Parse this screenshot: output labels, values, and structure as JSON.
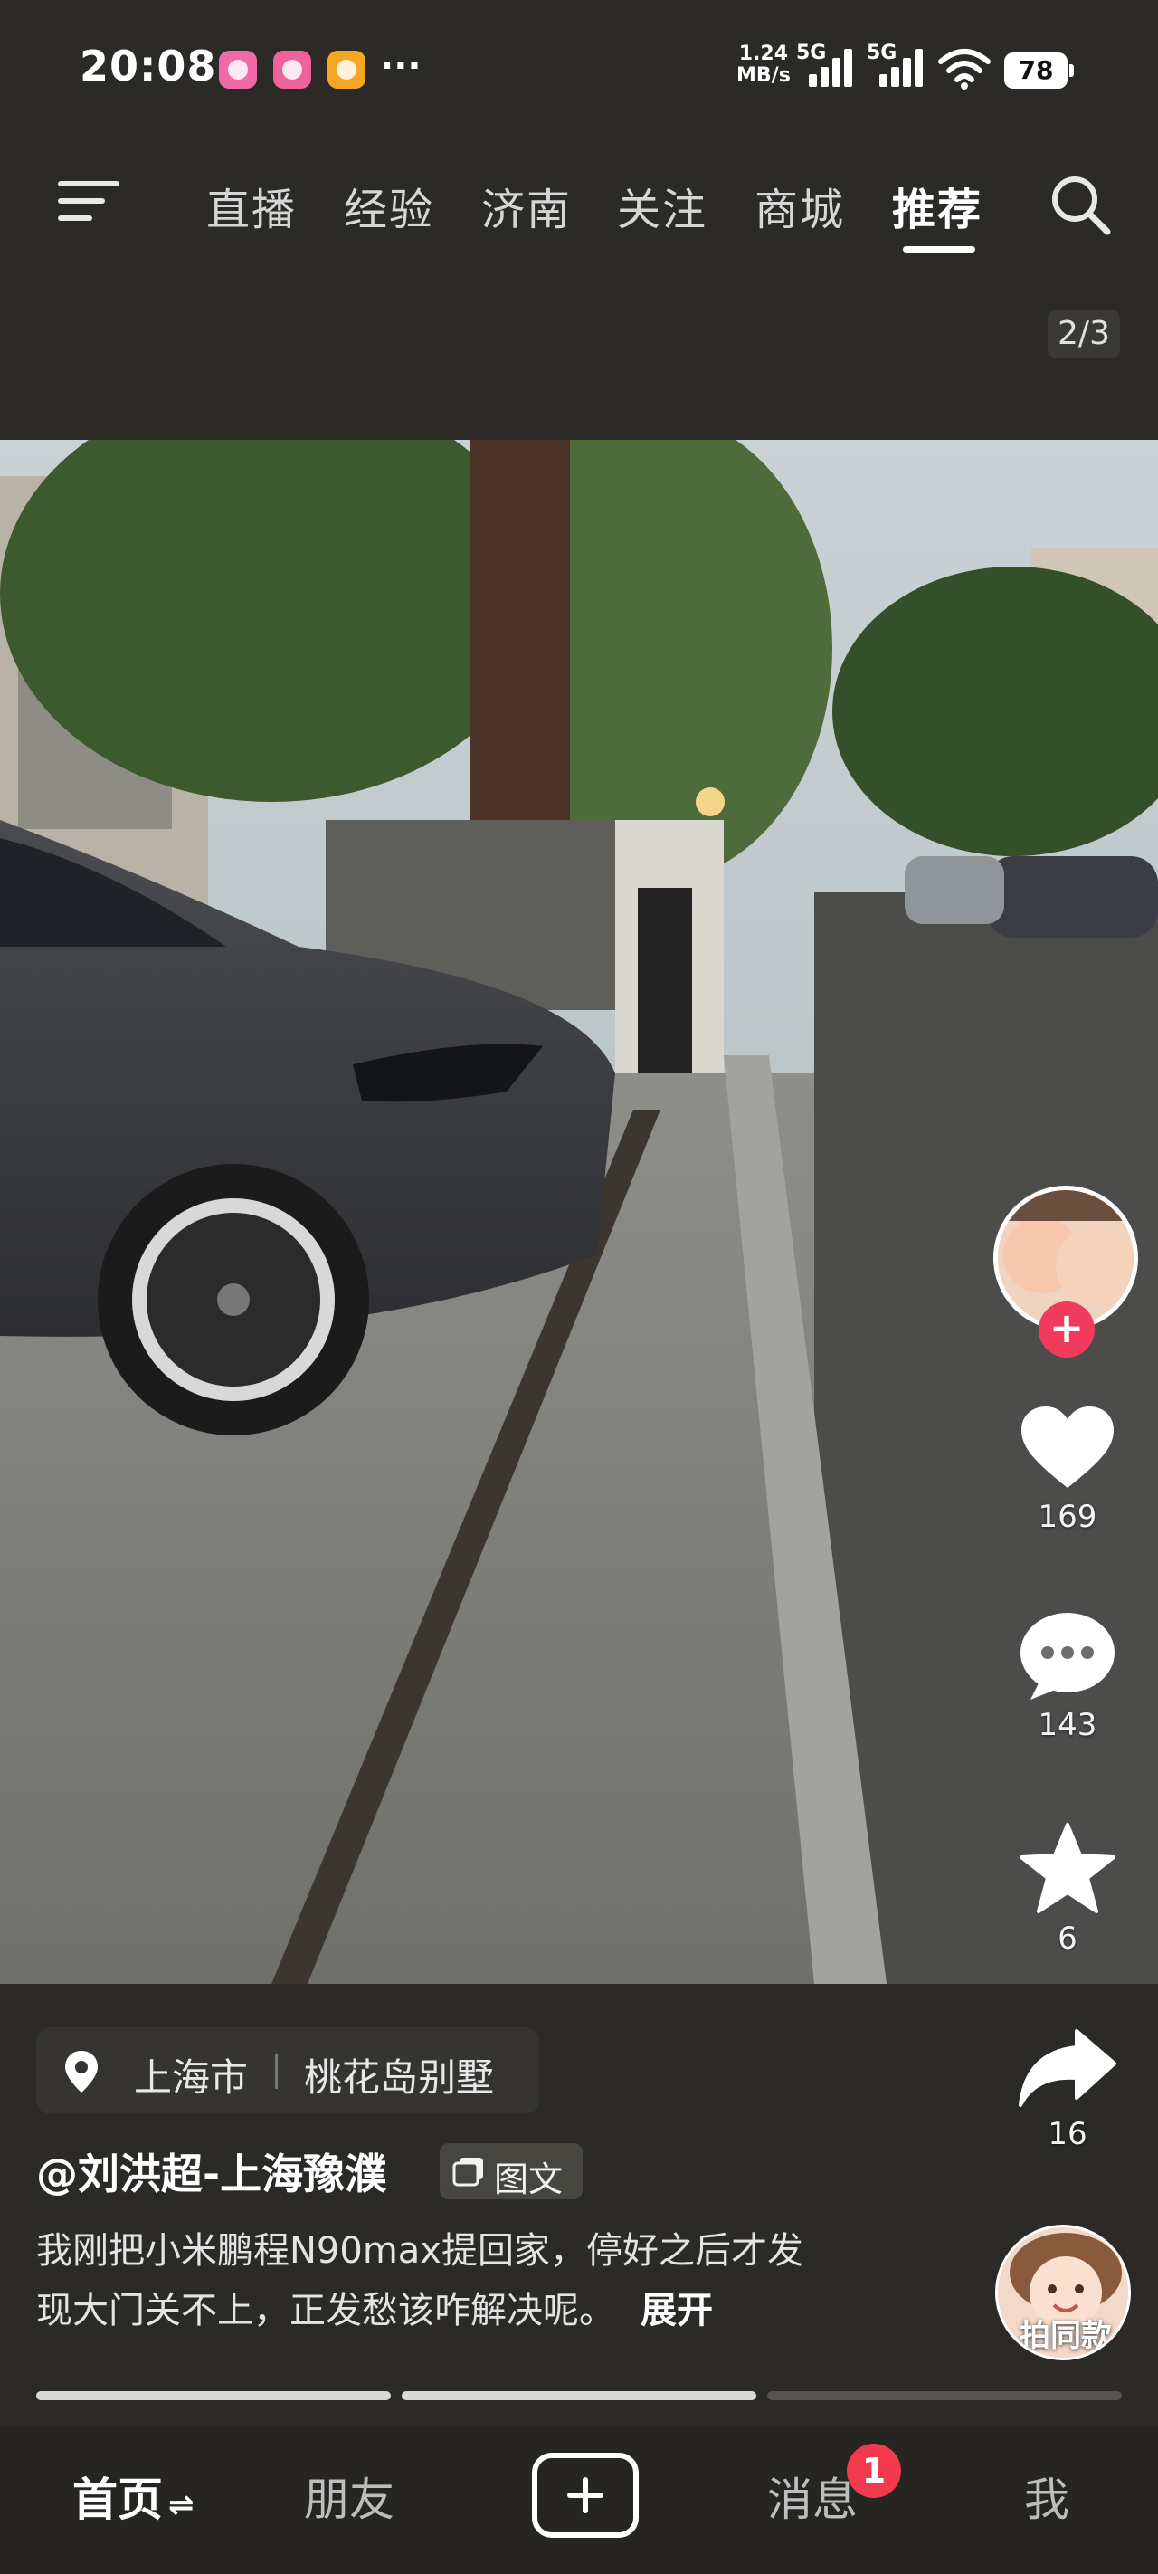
{
  "status_bar": {
    "time": "20:08",
    "more": "···",
    "net_speed_value": "1.24",
    "net_speed_unit": "MB/s",
    "signal1_label": "5G",
    "signal2_label": "5G",
    "battery": "78",
    "icons": [
      "app-notification-icon-1",
      "app-notification-icon-2",
      "app-notification-icon-3",
      "signal-icon",
      "wifi-icon",
      "battery-icon"
    ]
  },
  "nav": {
    "tabs": [
      {
        "label": "直播"
      },
      {
        "label": "经验"
      },
      {
        "label": "济南"
      },
      {
        "label": "关注"
      },
      {
        "label": "商城"
      },
      {
        "label": "推荐"
      }
    ],
    "active_tab": "推荐"
  },
  "media": {
    "page_counter": "2/3"
  },
  "actions": {
    "likes": "169",
    "comments": "143",
    "favorites": "6",
    "shares": "16",
    "follow_symbol": "+",
    "same_style_label": "拍同款"
  },
  "post": {
    "location_city": "上海市",
    "location_place": "桃花岛别墅",
    "author": "@刘洪超-上海豫濮",
    "type_badge": "图文",
    "caption_line1": "我刚把小米鹏程N90max提回家，停好之后才发",
    "caption_line2": "现大门关不上，正发愁该咋解决呢。",
    "expand_label": "展开",
    "image_progress": {
      "total": 3,
      "current": 2
    }
  },
  "bottom_nav": {
    "home": "首页",
    "home_suffix": "⇌",
    "friends": "朋友",
    "messages": "消息",
    "messages_badge": "1",
    "me": "我"
  },
  "colors": {
    "background": "#2b2a27",
    "accent_red": "#f23a5c",
    "text_primary": "#ffffff",
    "text_secondary": "#d6d6d6"
  }
}
